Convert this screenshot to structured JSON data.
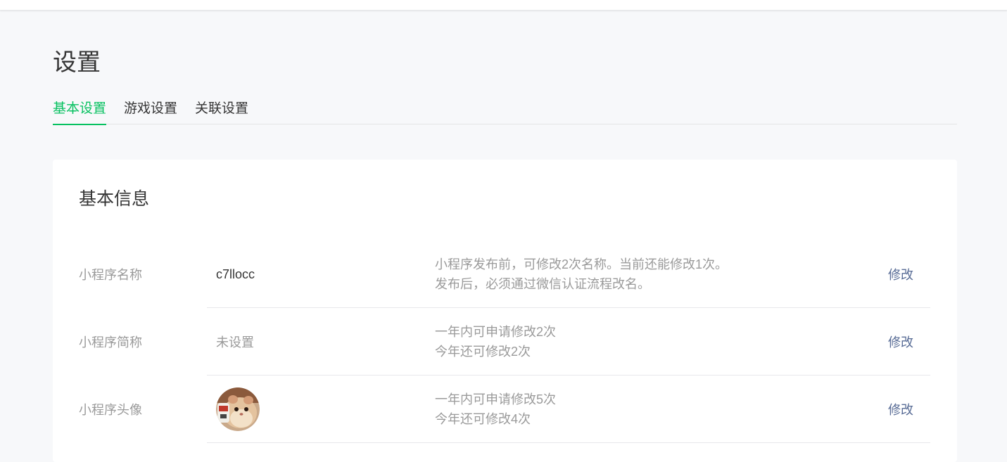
{
  "page": {
    "title": "设置"
  },
  "tabs": [
    {
      "label": "基本设置",
      "active": true
    },
    {
      "label": "游戏设置",
      "active": false
    },
    {
      "label": "关联设置",
      "active": false
    }
  ],
  "colors": {
    "accent": "#07c160",
    "link": "#576b95",
    "muted_text": "#9a9a9a",
    "background": "#f7f8fa"
  },
  "basic_info": {
    "title": "基本信息",
    "rows": [
      {
        "label": "小程序名称",
        "value": "c7llocc",
        "desc_line1": "小程序发布前，可修改2次名称。当前还能修改1次。",
        "desc_line2": "发布后，必须通过微信认证流程改名。",
        "action": "修改"
      },
      {
        "label": "小程序简称",
        "value": "未设置",
        "desc_line1": "一年内可申请修改2次",
        "desc_line2": "今年还可修改2次",
        "action": "修改"
      },
      {
        "label": "小程序头像",
        "avatar_icon": "hamster-avatar-image",
        "desc_line1": "一年内可申请修改5次",
        "desc_line2": "今年还可修改4次",
        "action": "修改"
      }
    ]
  }
}
